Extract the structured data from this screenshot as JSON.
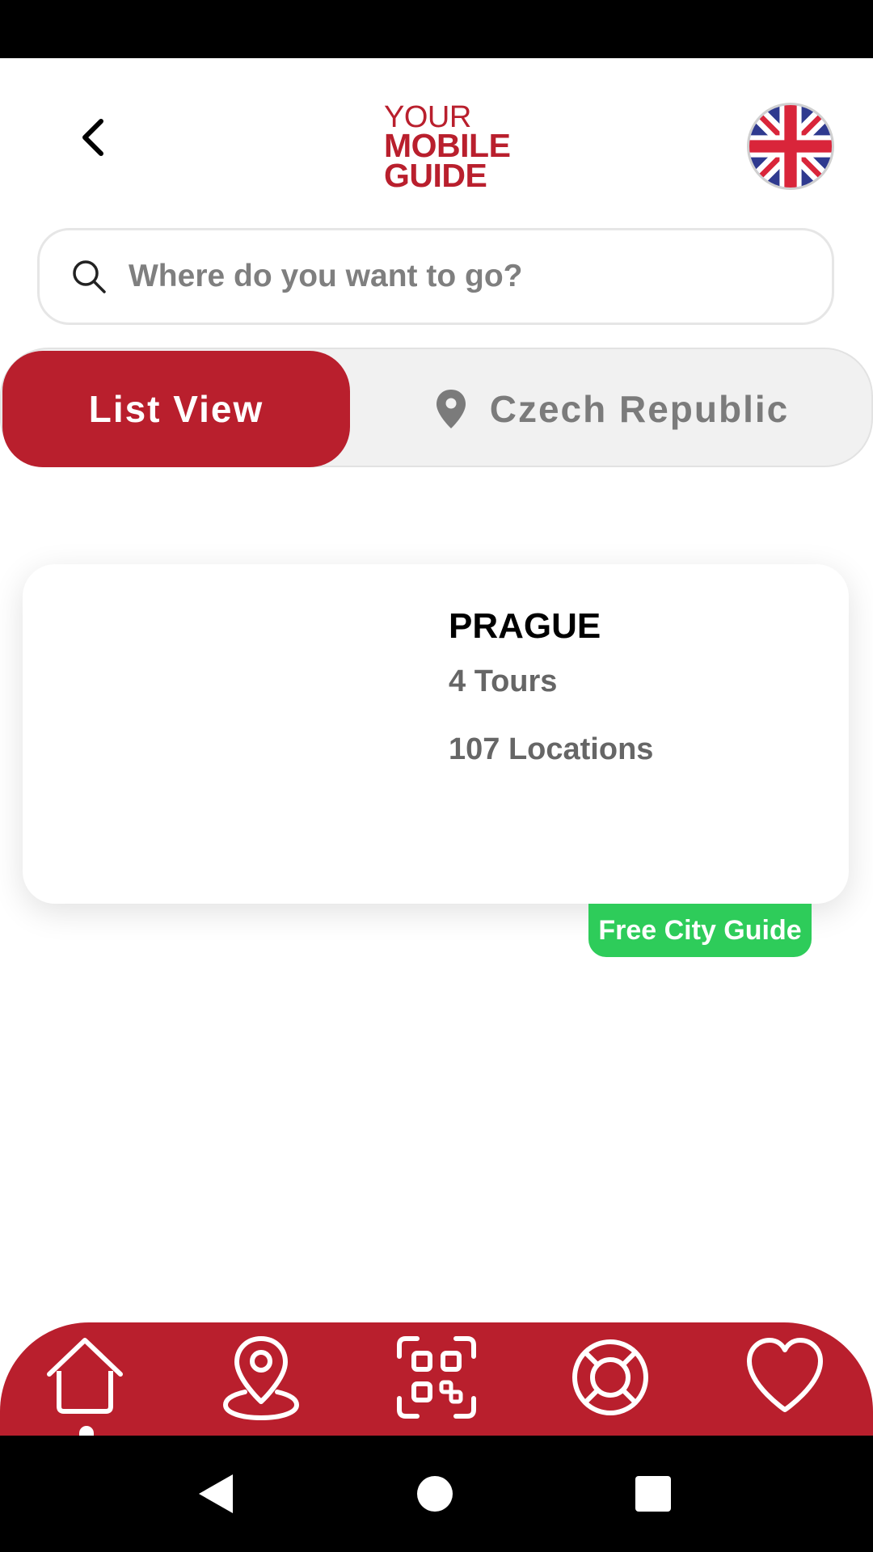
{
  "header": {
    "logo_line1": "YOUR",
    "logo_line2": "MOBILE",
    "logo_line3": "GUIDE",
    "language_flag": "uk-flag-icon"
  },
  "search": {
    "placeholder": "Where do you want to go?"
  },
  "view_toggle": {
    "list_view_label": "List View",
    "country_label": "Czech Republic"
  },
  "cities": [
    {
      "name": "PRAGUE",
      "tours": "4 Tours",
      "locations": "107 Locations",
      "badge": "Free City Guide"
    }
  ],
  "bottom_nav": {
    "items": [
      "home-icon",
      "map-pin-icon",
      "qr-code-icon",
      "lifebuoy-icon",
      "heart-icon"
    ],
    "active": "home-icon"
  },
  "colors": {
    "brand_red": "#b91f2d",
    "badge_green": "#2ecc5a",
    "muted_text": "#7b7b7b"
  }
}
